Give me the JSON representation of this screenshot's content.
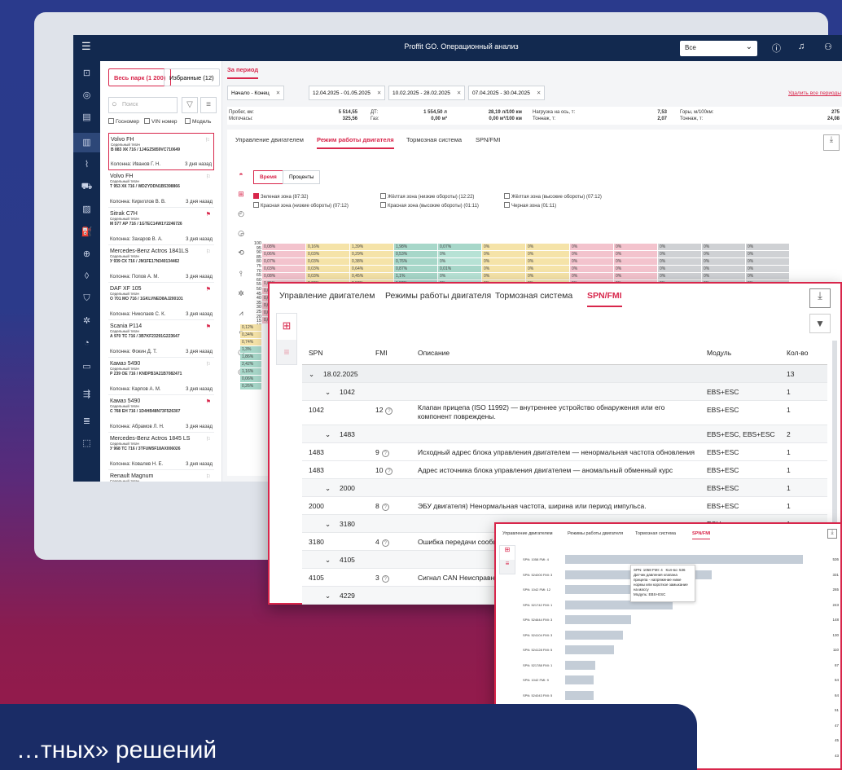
{
  "app": {
    "title": "Proffit GO. Операционный анализ",
    "select": "Все"
  },
  "fleet": {
    "tab_all": "Весь парк (1 200)",
    "tab_fav": "Избранные (12)",
    "search": "Поиск",
    "filters": [
      "Госномер",
      "VIN номер",
      "Модель"
    ],
    "vehicles": [
      {
        "name": "Volvo FH",
        "type": "Седельный тягач",
        "plate": "В 883 ХК 716 / 1J4GZ5859VC710649",
        "col": "Колонна: Иванов Г. Н.",
        "ago": "3 дня назад",
        "flag": false
      },
      {
        "name": "Volvo FH",
        "type": "Седельный тягач",
        "plate": "Т 953 ХК 716 / WDZYDDN1B5398866",
        "col": "Колонна: Кириллов В. В.",
        "ago": "3 дня назад",
        "flag": false
      },
      {
        "name": "Sitrak C7H",
        "type": "Седельный тягач",
        "plate": "М 577 АР 716 / 1GTEC14W1Y2246726",
        "col": "Колонна: Захаров В. А.",
        "ago": "3 дня назад",
        "flag": true
      },
      {
        "name": "Mercedes-Benz Actros 1841LS",
        "type": "Седельный тягач",
        "plate": "У 939 СХ 716 / JM1FE17N340134462",
        "col": "Колонна: Попов А. М.",
        "ago": "3 дня назад",
        "flag": false
      },
      {
        "name": "DAF XF 105",
        "type": "Седельный тягач",
        "plate": "О 701 МО 716 / 1GKLVNED8AJ200101",
        "col": "Колонна: Николаев С. К.",
        "ago": "3 дня назад",
        "flag": true
      },
      {
        "name": "Scania P114",
        "type": "Седельный тягач",
        "plate": "А 970 ТС 716 / 3B7KF23291G223647",
        "col": "Колонна: Фокин Д. Т.",
        "ago": "3 дня назад",
        "flag": true
      },
      {
        "name": "Камаз 5490",
        "type": "Седельный тягач",
        "plate": "Р 239 ОЕ 716 / KNDPB3A21B7082471",
        "col": "Колонна: Карпов А. М.",
        "ago": "3 дня назад",
        "flag": false
      },
      {
        "name": "Камаз 5490",
        "type": "Седельный тягач",
        "plate": "С 768 ЕН 716 / 1D4HB48N73F526307",
        "col": "Колонна: Абрамов Л. Н.",
        "ago": "3 дня назад",
        "flag": true
      },
      {
        "name": "Mercedes-Benz Actros 1845 LS",
        "type": "Седельный тягач",
        "plate": "У 968 ТС 716 / 3TFUM5F18AX006026",
        "col": "Колонна: Ковалев Н. Е.",
        "ago": "3 дня назад",
        "flag": false
      },
      {
        "name": "Renault Magnum",
        "type": "Седельный тягач",
        "plate": "С 038 КО 716 / 2G1WL54T4R9165225",
        "col": "Колонна: Полунькин А. А.",
        "ago": "3 дня назад",
        "flag": false
      }
    ]
  },
  "period": {
    "label": "За период",
    "chips": [
      "Начало  -  Конец",
      "12.04.2025 - 01.05.2025",
      "10.02.2025 - 28.02.2025",
      "07.04.2025 - 30.04.2025"
    ],
    "delete_all": "Удалить все периоды"
  },
  "stats": [
    {
      "l1": "Пробег, км:",
      "l2": "Моточасы:",
      "v1": "5 514,55",
      "v2": "325,56"
    },
    {
      "l1": "ДТ:",
      "l2": "Газ:",
      "v1": "1 554,50 л",
      "v2": "0,00 м³"
    },
    {
      "l1": "",
      "l2": "",
      "v1": "28,19 л/100 км",
      "v2": "0,00 м³/100 км"
    },
    {
      "l1": "Нагрузка на ось, т:",
      "l2": "Тоннаж, т:",
      "v1": "7,53",
      "v2": "2,07"
    },
    {
      "l1": "Горы, м/100км:",
      "l2": "Тоннаж, т:",
      "v1": "275",
      "v2": "24,08"
    }
  ],
  "card": {
    "tabs": [
      "Управление двигателем",
      "Режим работы двигателя",
      "Тормозная система",
      "SPN/FMI"
    ],
    "active": 1,
    "view_tabs": [
      "Время",
      "Проценты"
    ],
    "zones": [
      "Зеленая зона (87:32)",
      "Красная зона (низкие обороты) (07:12)",
      "Жёлтая зона (низкие обороты) (12:22)",
      "Красная зона (высокие обороты) (01:11)",
      "Жёлтая зона (высокие обороты) (07:12)",
      "Черная зона (01:11)"
    ],
    "ylabels": [
      "100",
      "95",
      "90",
      "85",
      "80",
      "75",
      "70",
      "65",
      "60",
      "55",
      "50",
      "45",
      "40",
      "35",
      "30",
      "25",
      "20",
      "15",
      "10",
      "5",
      "0"
    ],
    "heat_rows": [
      [
        "0,08%",
        "0,16%",
        "1,39%",
        "1,98%",
        "0,07%"
      ],
      [
        "0,06%",
        "0,03%",
        "0,29%",
        "0,53%",
        "0%"
      ],
      [
        "0,07%",
        "0,03%",
        "0,38%",
        "0,76%",
        "0%"
      ],
      [
        "0,03%",
        "0,03%",
        "0,64%",
        "0,87%",
        "0,01%"
      ],
      [
        "0,08%",
        "0,03%",
        "0,45%",
        "1,1%",
        "0%"
      ],
      [
        "0,05%",
        "0,02%",
        "0,52%",
        "1,52%",
        "0%"
      ],
      [
        "0,04%",
        "0,03%",
        "0,55%",
        "1,95%",
        "0%"
      ],
      [
        "0,02%",
        "0,04%",
        "0,56%",
        "2,8%",
        "0%"
      ],
      [
        "0,02%",
        "0,03%",
        "0,5%",
        "5,61%",
        "0,01%"
      ],
      [
        "0,04%",
        "0,04%",
        "0,42%",
        "9,83%",
        "0,01%"
      ],
      [
        "0,05%",
        "0,09%",
        "0,44%",
        "13,01%",
        "0%"
      ]
    ],
    "left_col": [
      "0,12%",
      "0,34%",
      "0,74%",
      "1,3%",
      "1,86%",
      "2,42%",
      "1,16%",
      "0,06%",
      "0,26%"
    ]
  },
  "spn": {
    "tabs": [
      "Управление двигателем",
      "Режимы работы двигателя",
      "Тормозная система",
      "SPN/FMI"
    ],
    "headers": [
      "SPN",
      "FMI",
      "Описание",
      "Модуль",
      "Кол-во"
    ],
    "rows": [
      {
        "t": "grp",
        "spn": "18.02.2025",
        "mod": "",
        "cnt": "13"
      },
      {
        "t": "sub",
        "spn": "1042",
        "mod": "EBS+ESC",
        "cnt": "1"
      },
      {
        "t": "row",
        "spn": "1042",
        "fmi": "12",
        "desc": "Клапан прицепа (ISO 11992) — внутреннее устройство обнаружения или его компонент повреждены.",
        "mod": "EBS+ESC",
        "cnt": "1"
      },
      {
        "t": "sub",
        "spn": "1483",
        "mod": "EBS+ESC, EBS+ESC",
        "cnt": "2"
      },
      {
        "t": "row",
        "spn": "1483",
        "fmi": "9",
        "desc": "Исходный адрес блока управления двигателем — ненормальная частота обновления",
        "mod": "EBS+ESC",
        "cnt": "1"
      },
      {
        "t": "row",
        "spn": "1483",
        "fmi": "10",
        "desc": "Адрес источника блока управления двигателем — аномальный обменный курс",
        "mod": "EBS+ESC",
        "cnt": "1"
      },
      {
        "t": "sub",
        "spn": "2000",
        "mod": "EBS+ESC",
        "cnt": "1"
      },
      {
        "t": "row",
        "spn": "2000",
        "fmi": "8",
        "desc": "ЭБУ двигателя) Ненормальная частота, ширина или период импульса.",
        "mod": "EBS+ESC",
        "cnt": "1"
      },
      {
        "t": "sub",
        "spn": "3180",
        "mod": "TCU",
        "cnt": "1"
      },
      {
        "t": "row",
        "spn": "3180",
        "fmi": "4",
        "desc": "Ошибка передачи сообщения",
        "mod": "",
        "cnt": ""
      },
      {
        "t": "sub",
        "spn": "4105",
        "mod": "",
        "cnt": ""
      },
      {
        "t": "row",
        "spn": "4105",
        "fmi": "3",
        "desc": "Сигнал CAN Неисправность",
        "mod": "",
        "cnt": ""
      },
      {
        "t": "sub",
        "spn": "4229",
        "mod": "",
        "cnt": ""
      }
    ]
  },
  "chart_data": {
    "type": "bar",
    "orientation": "horizontal",
    "categories": [
      "SPN: 1058  FMI: 4",
      "SPN: 524000  FMI: 3",
      "SPN: 1042  FMI: 12",
      "SPN: 521742  FMI: 1",
      "SPN: 524644  FMI: 3",
      "SPN: 524104  FMI: 3",
      "SPN: 524128  FMI: 5",
      "SPN: 521788  FMI: 1",
      "SPN: 1042  FMI: 9",
      "SPN: 524043  FMI: 5",
      "SPN: 524215  FMI: 2",
      "SPN: 4128  FMI: 4",
      "SPN: 3211  FMI: 4",
      "SPN: 4105  FMI: 3",
      "SPN: 521748  FMI: 1"
    ],
    "values": [
      536,
      331,
      265,
      243,
      148,
      130,
      110,
      67,
      64,
      64,
      51,
      47,
      45,
      43,
      36
    ],
    "extra_values": [
      35,
      34
    ],
    "tabs": [
      "Управление двигателем",
      "Режимы работы двигателя",
      "Тормозная система",
      "SPN/FMI"
    ],
    "tooltip": {
      "line1": "SPN: 1058  FMI: 4",
      "line1b": "Кол-во: 536",
      "desc": "Датчик давления клапана прицепа - напряжение ниже нормы или короткое замыкание на массу",
      "module": "Модуль: EBS+ESC"
    }
  },
  "banner": {
    "text": "…тных» решений"
  }
}
